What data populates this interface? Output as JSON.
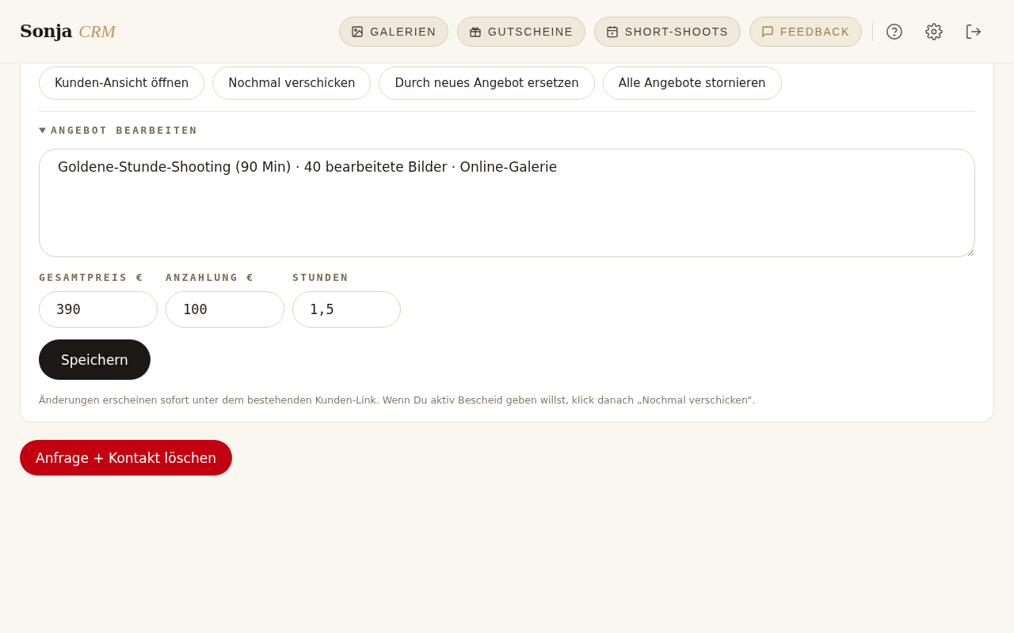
{
  "brand": {
    "name": "Sonja",
    "suffix": "CRM"
  },
  "nav": [
    {
      "label": "GALERIEN",
      "kind": "image",
      "accent": false
    },
    {
      "label": "GUTSCHEINE",
      "kind": "gift",
      "accent": false
    },
    {
      "label": "SHORT-SHOOTS",
      "kind": "calendar",
      "accent": false
    },
    {
      "label": "FEEDBACK",
      "kind": "message",
      "accent": true
    }
  ],
  "header_actions": [
    {
      "kind": "help"
    },
    {
      "kind": "settings"
    },
    {
      "kind": "logout"
    }
  ],
  "offer_actions": [
    "Kunden-Ansicht öffnen",
    "Nochmal verschicken",
    "Durch neues Angebot ersetzen",
    "Alle Angebote stornieren"
  ],
  "editor": {
    "title": "ANGEBOT BEARBEITEN",
    "expanded": true,
    "description": "Goldene-Stunde-Shooting (90 Min) · 40 bearbeitete Bilder · Online-Galerie",
    "fields": [
      {
        "label": "GESAMTPREIS €",
        "value": "390"
      },
      {
        "label": "ANZAHLUNG €",
        "value": "100"
      },
      {
        "label": "STUNDEN",
        "value": "1,5"
      }
    ],
    "save_button": "Speichern",
    "hint": "Änderungen erscheinen sofort unter dem bestehenden Kunden-Link. Wenn Du aktiv Bescheid geben willst, klick danach „Nochmal verschicken“."
  },
  "delete_button": "Anfrage + Kontakt löschen"
}
